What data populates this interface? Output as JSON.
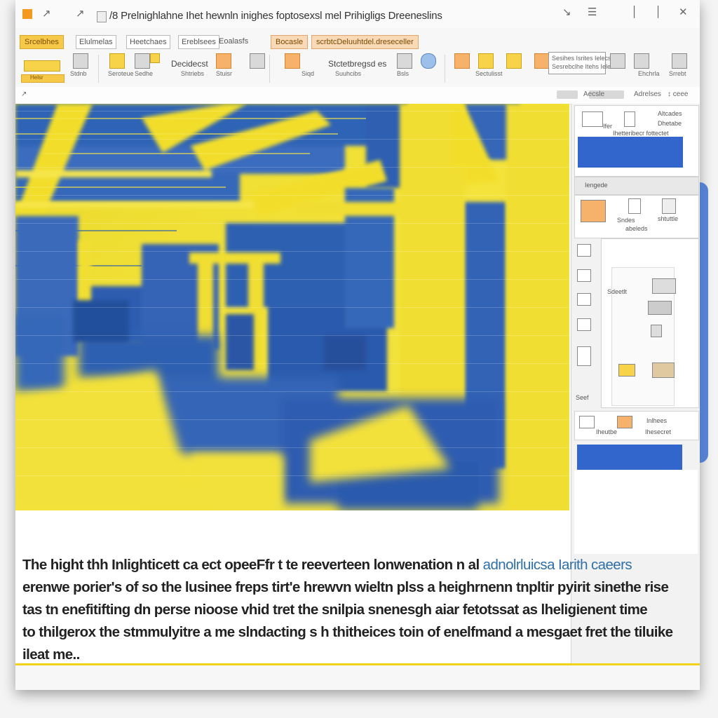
{
  "window": {
    "title": "/8 Prelnighlahne Ihet hewnln inighes foptosexsl mel Prihigligs Dreeneslins",
    "quick_access": [
      "↗",
      "↗"
    ],
    "controls": {
      "minimize": "↘",
      "restore": "☰",
      "pin": "│",
      "pin2": "│",
      "close": "✕"
    }
  },
  "ribbon": {
    "tabs": [
      {
        "label": "Srcelbhes",
        "style": "active"
      },
      {
        "label": "Elulmelas",
        "style": "plain"
      },
      {
        "label": "Heetchaes",
        "style": "plain"
      },
      {
        "label": "Ereblsees",
        "style": "plain"
      },
      {
        "label": "Bocasle",
        "style": "ctx"
      },
      {
        "label": "scrbtcDeluuhtdel.dreseceller",
        "style": "ctx"
      }
    ],
    "groups": [
      {
        "label": "Stdnb"
      },
      {
        "label": "Seroteue"
      },
      {
        "label": "Sedhe"
      },
      {
        "label": "Decidecst"
      },
      {
        "label": "Shtriebs"
      },
      {
        "label": "Stuisr"
      },
      {
        "label": "Siqd"
      },
      {
        "label": "Stctetbregsd es"
      },
      {
        "label": "Suuhcibs"
      },
      {
        "label": "Bsls"
      },
      {
        "label": "Sectulisst"
      },
      {
        "label": "Ehchrla"
      },
      {
        "label": "Srrebt"
      }
    ],
    "style_box": [
      "Sesihes Isrites Ielecs",
      "Sesrebclhe Itehs Ielecs"
    ],
    "highlight_label": "Helsr"
  },
  "subbar": {
    "items": [
      "Aecsle",
      "Adrelses",
      "↕ ceee"
    ]
  },
  "panel": {
    "section1": [
      "Altcades",
      "Ifer",
      "Dhetabe",
      "Ihetteribecr fottectet"
    ],
    "section2": "Iengede",
    "section3": [
      "Sndes",
      "shtuttle",
      "abeleds"
    ],
    "section4": [
      "Sdeetlt",
      "Seef"
    ],
    "section5": [
      "Iheutbe",
      "Inlhees",
      "Ihesecret"
    ],
    "colors": {
      "accent": "#3366cc"
    }
  },
  "body": {
    "lines": [
      "The hight thh Inlighticett ca ect opeeFfr t te reeverteen lonwenation  n al",
      "erenwe porier's of so the lusinee freps tirt'e hrewvn wieltn plss a heighrnenn tnpltir pyirit sinethe rise",
      "tas tn enefitifting dn perse nioose vhid tret the snilpia snenesgh  aiar fetotssat as lheligienent time",
      "to thilgerox  the stmmulyitre a me slndacting s h thitheices toin of enelfmand a mesgaet fret the tiluike",
      "ileat me.."
    ],
    "accent": "adnolrluicsa Iarith caeers"
  }
}
